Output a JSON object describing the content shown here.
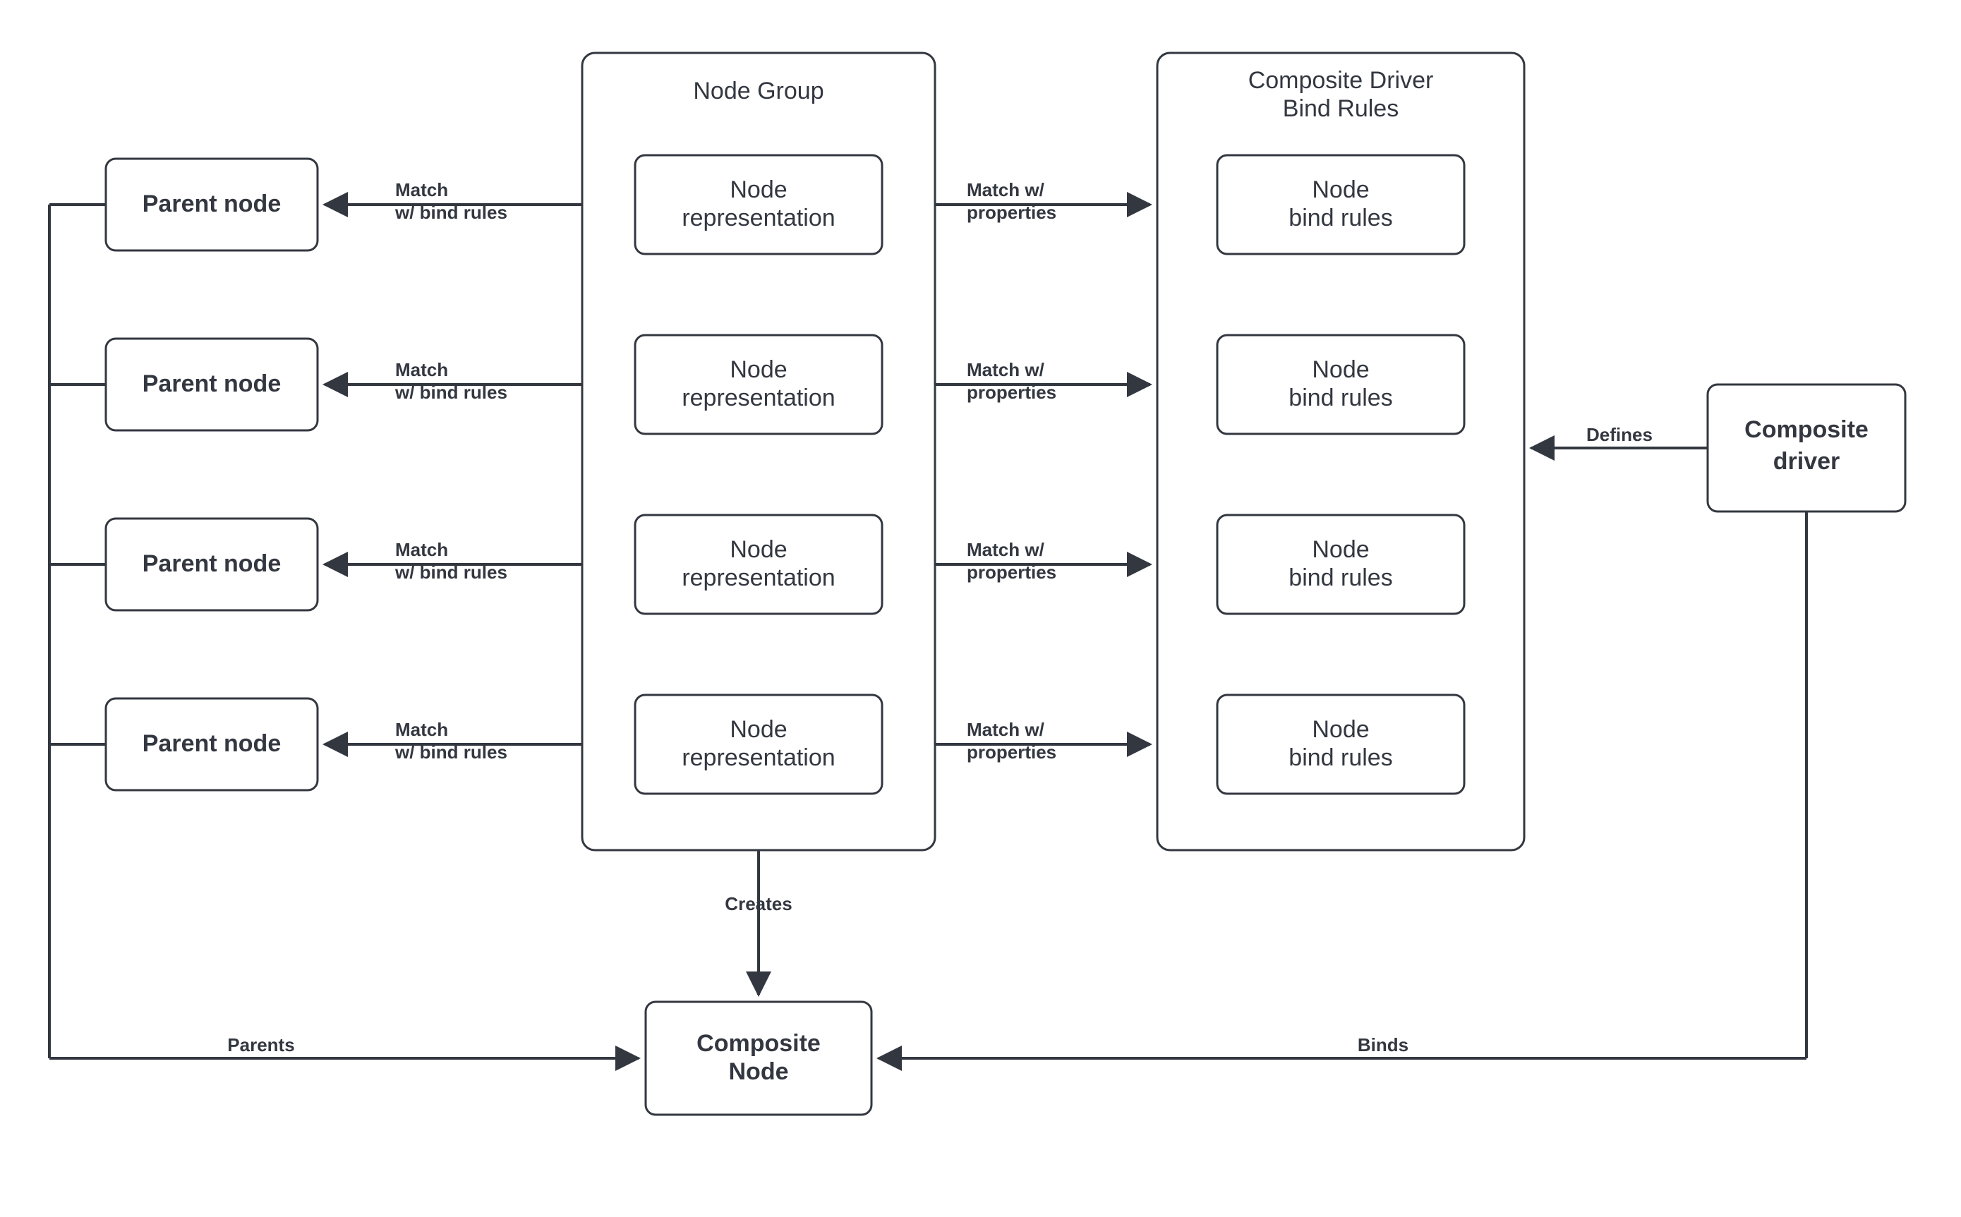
{
  "groups": {
    "nodeGroup": {
      "title": "Node Group"
    },
    "bindRules": {
      "title_l1": "Composite Driver",
      "title_l2": "Bind Rules"
    }
  },
  "parents": [
    {
      "label": "Parent node"
    },
    {
      "label": "Parent node"
    },
    {
      "label": "Parent node"
    },
    {
      "label": "Parent  node"
    }
  ],
  "reps": [
    {
      "l1": "Node",
      "l2": "representation"
    },
    {
      "l1": "Node",
      "l2": "representation"
    },
    {
      "l1": "Node",
      "l2": "representation"
    },
    {
      "l1": "Node",
      "l2": "representation"
    }
  ],
  "rules": [
    {
      "l1": "Node",
      "l2": "bind rules"
    },
    {
      "l1": "Node",
      "l2": "bind rules"
    },
    {
      "l1": "Node",
      "l2": "bind rules"
    },
    {
      "l1": "Node",
      "l2": "bind rules"
    }
  ],
  "compositeDriver": {
    "l1": "Composite",
    "l2": "driver"
  },
  "compositeNode": {
    "l1": "Composite",
    "l2": "Node"
  },
  "edgeLabels": {
    "matchBind_l1": "Match",
    "matchBind_l2": "w/ bind rules",
    "matchProps_l1": "Match w/",
    "matchProps_l2": "properties",
    "defines": "Defines",
    "creates": "Creates",
    "parents": "Parents",
    "binds": "Binds"
  }
}
